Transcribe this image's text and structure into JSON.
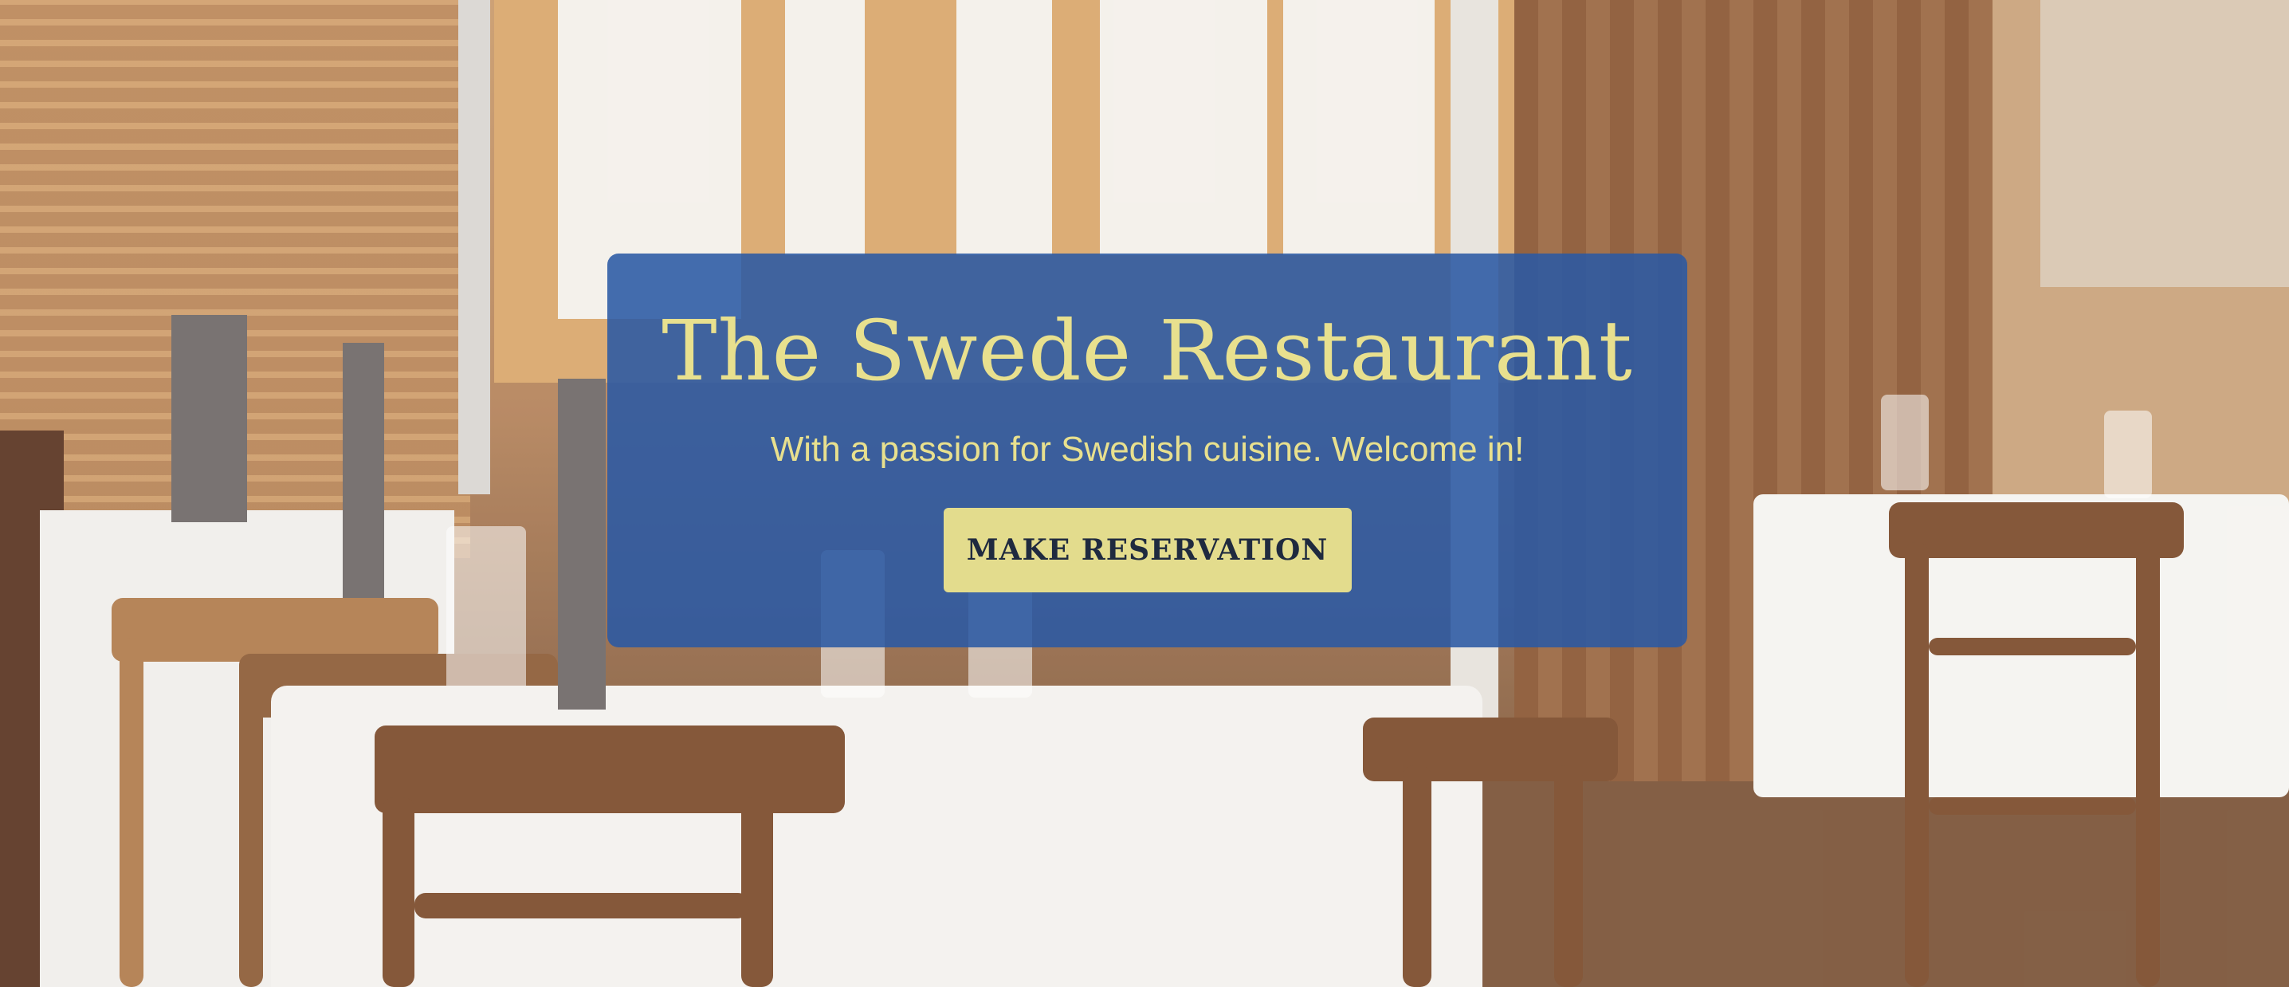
{
  "hero": {
    "title": "The Swede Restaurant",
    "subtitle": "With a passion for Swedish cuisine. Welcome in!",
    "cta_label": "MAKE RESERVATION"
  },
  "colors": {
    "card_background": "#2a59a4",
    "heading_text": "#e8e08e",
    "button_background": "#e3dc8d",
    "button_text": "#1f2a3f"
  },
  "background": {
    "image": "restaurant-interior-photo"
  }
}
